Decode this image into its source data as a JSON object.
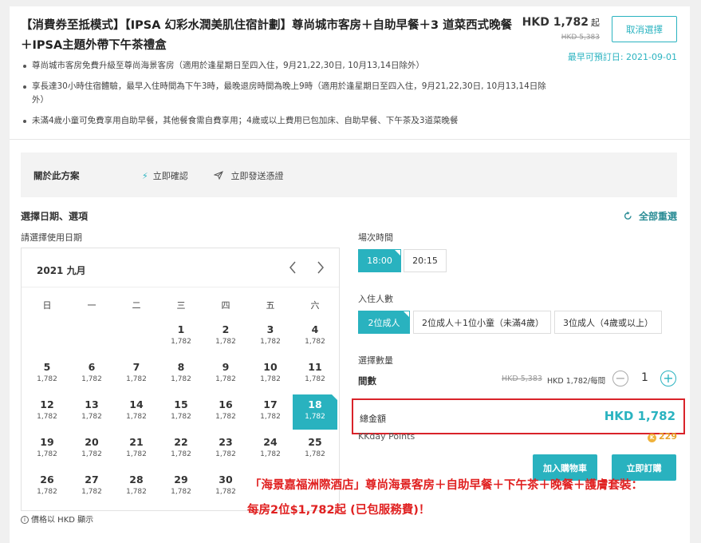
{
  "product": {
    "title": "【消費券至抵模式】【IPSA 幻彩水潤美肌住宿計劃】尊尚城市客房＋自助早餐＋3 道菜西式晚餐＋IPSA主題外帶下午茶禮盒",
    "price": "HKD 1,782",
    "price_suffix": "起",
    "original_price": "HKD 5,383",
    "cancel_label": "取消選擇",
    "earliest_label": "最早可預訂日: 2021-09-01",
    "bullets": [
      "尊尚城市客房免費升級至尊尚海景客房（適用於逢星期日至四入住，9月21,22,30日, 10月13,14日除外）",
      "享長達30小時住宿體驗，最早入住時間為下午3時，最晚退房時間為晚上9時（適用於逢星期日至四入住，9月21,22,30日, 10月13,14日除外）",
      "未滿4歲小童可免費享用自助早餐，其他餐食需自費享用；4歲或以上費用已包加床、自助早餐、下午茶及3道菜晚餐"
    ]
  },
  "about": {
    "title": "關於此方案",
    "instant_confirm": "立即確認",
    "instant_send": "立即發送憑證"
  },
  "selection": {
    "title": "選擇日期、選項",
    "reset": "全部重選",
    "date_label": "請選擇使用日期",
    "price_note": "價格以 HKD 顯示"
  },
  "calendar": {
    "month": "2021 九月",
    "weekdays": [
      "日",
      "一",
      "二",
      "三",
      "四",
      "五",
      "六"
    ],
    "default_price": "1,782",
    "first_weekday": 3,
    "days_in_month": 30,
    "selected_day": 18
  },
  "session": {
    "label": "場次時間",
    "options": [
      "18:00",
      "20:15"
    ]
  },
  "guests": {
    "label": "入住人數",
    "options": [
      "2位成人",
      "2位成人＋1位小童（未滿4歲）",
      "3位成人（4歲或以上）"
    ]
  },
  "quantity": {
    "label": "選擇數量",
    "item": "間數",
    "original_price": "HKD 5,383",
    "unit_price": "HKD 1,782/每間",
    "value": "1"
  },
  "total": {
    "label": "總金額",
    "value": "HKD 1,782"
  },
  "points": {
    "label": "KKday Points",
    "value": "229"
  },
  "actions": {
    "add_to_cart": "加入購物車",
    "book_now": "立即訂購"
  },
  "promo": {
    "line1": "「海景嘉福洲際酒店」尊尚海景客房＋自助早餐＋下午茶＋晚餐＋護膚套裝：",
    "line2": "每房2位$1,782起 (已包服務費)！"
  }
}
